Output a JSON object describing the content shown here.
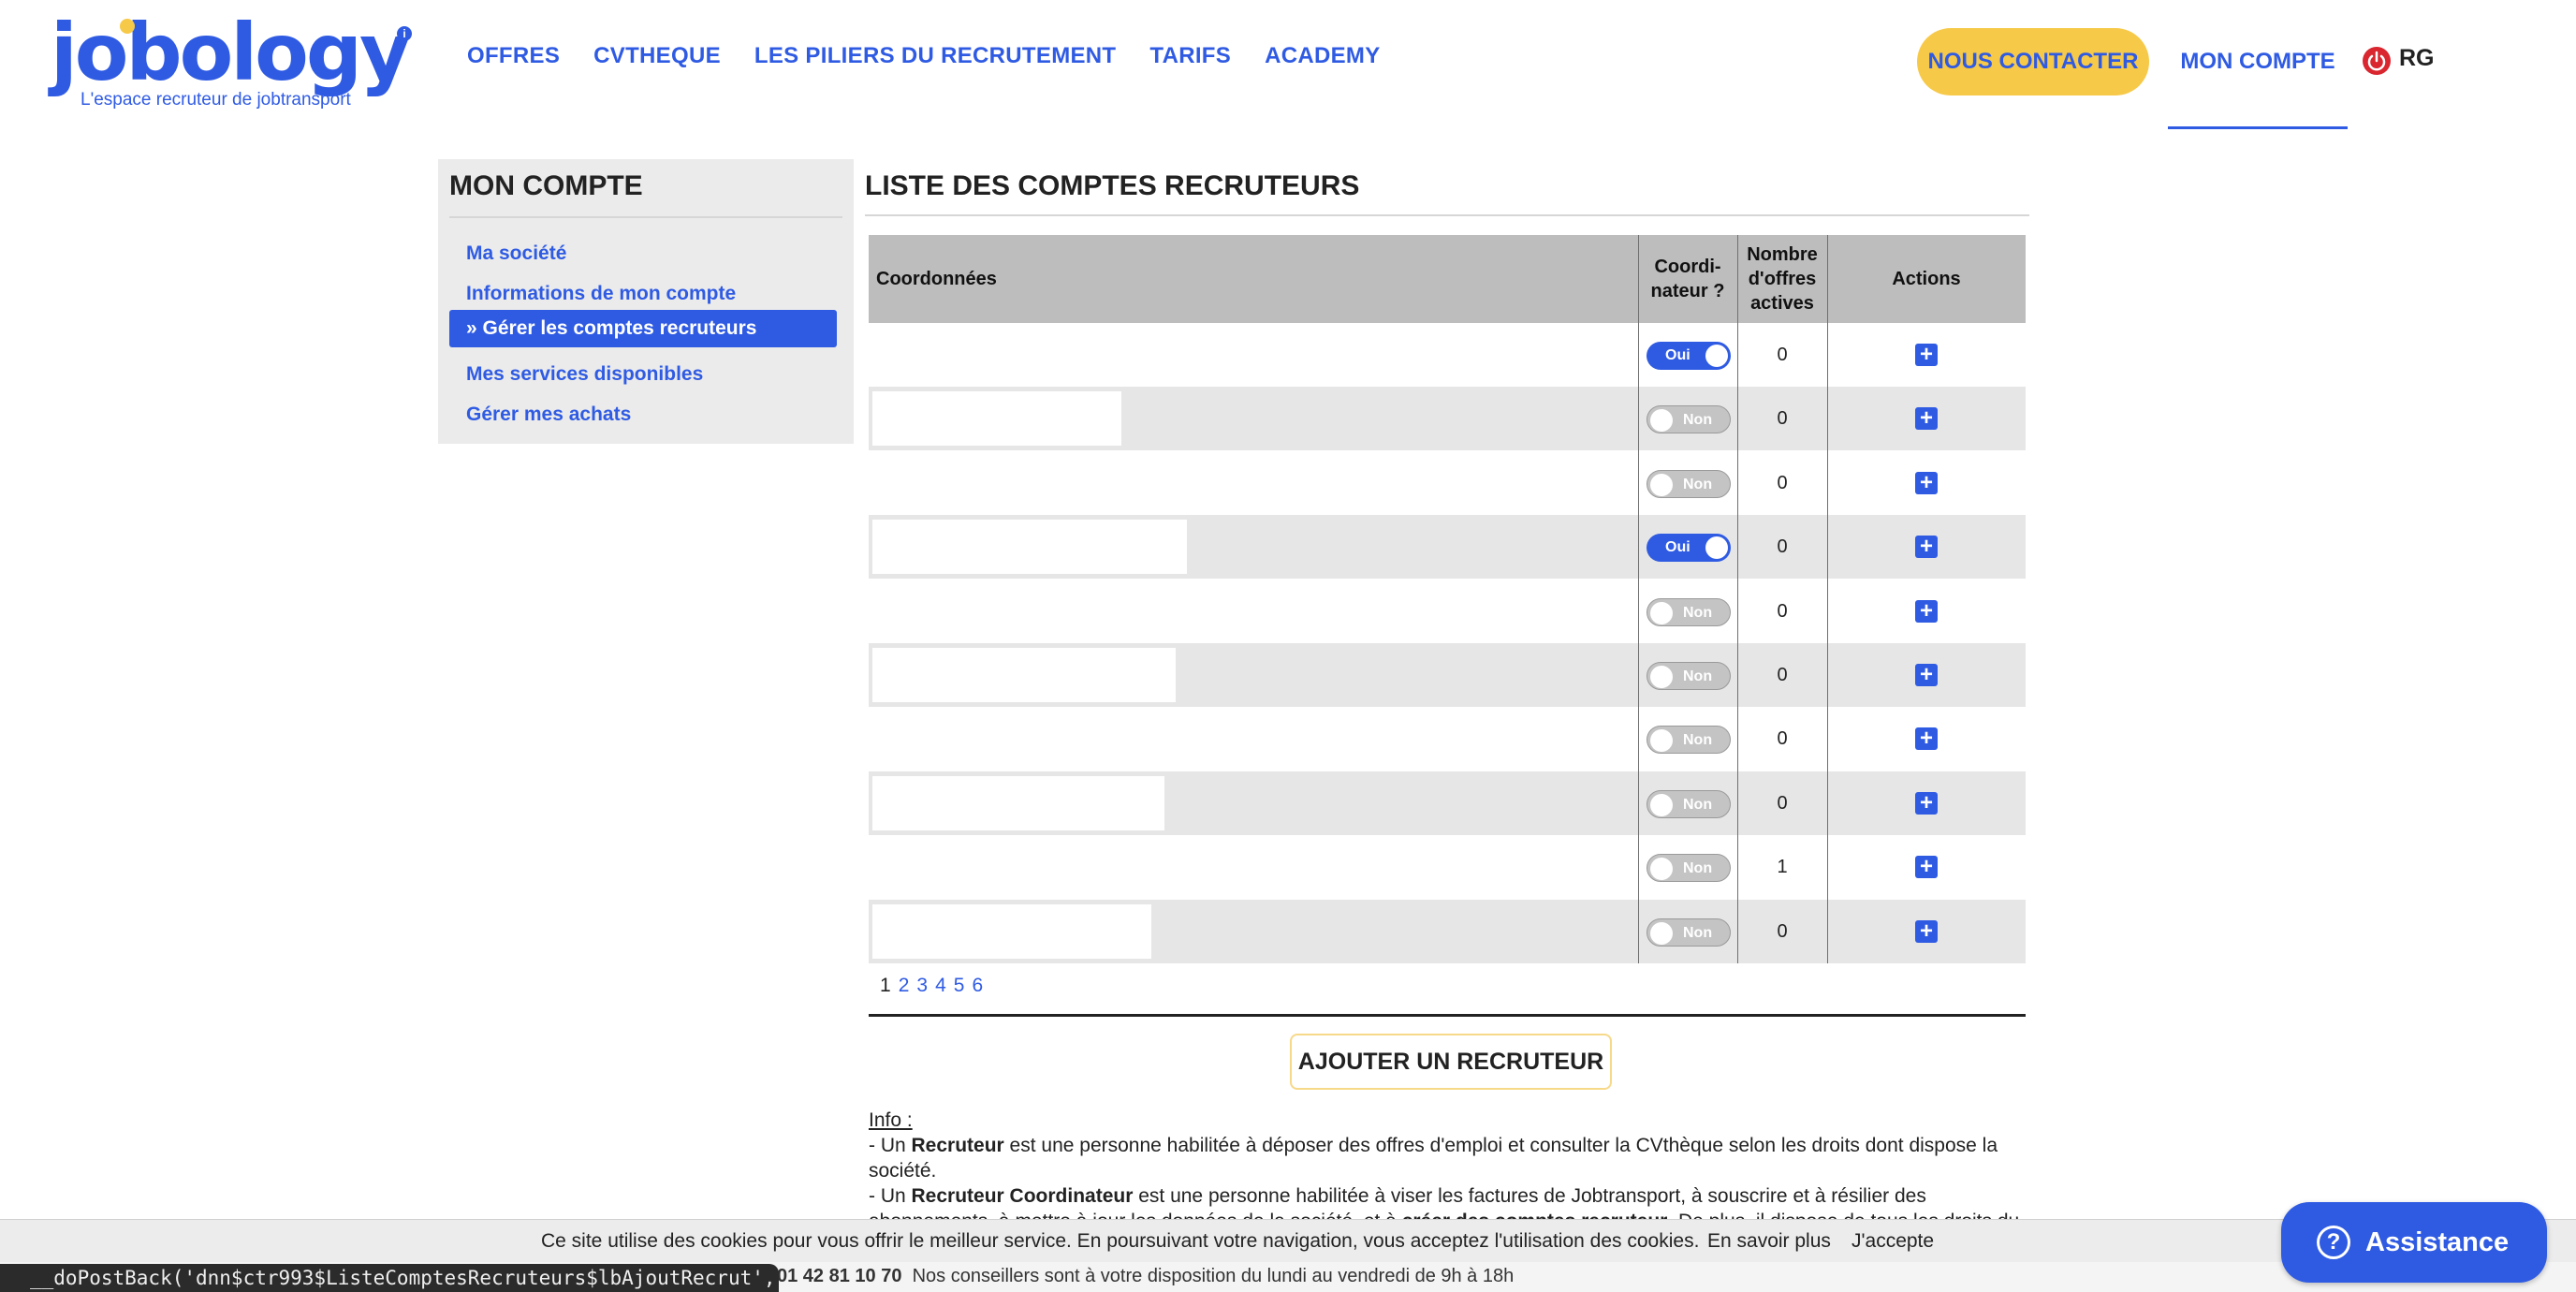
{
  "header": {
    "logo_text": "jobology",
    "logo_tagline": "L'espace recruteur de jobtransport",
    "nav": [
      "OFFRES",
      "CVTHEQUE",
      "LES PILIERS DU RECRUTEMENT",
      "TARIFS",
      "ACADEMY"
    ],
    "contact_label": "NOUS CONTACTER",
    "account_label": "MON COMPTE",
    "user_initials": "RG",
    "accent_color": "#2f5be3",
    "highlight_color": "#f7c948"
  },
  "sidebar": {
    "title": "MON COMPTE",
    "items": [
      {
        "label": "Ma société"
      },
      {
        "label": "Informations de mon compte"
      },
      {
        "label": "» Gérer les comptes recruteurs",
        "active": true
      },
      {
        "label": "Mes services disponibles"
      },
      {
        "label": "Gérer mes achats"
      }
    ]
  },
  "main": {
    "title": "LISTE DES COMPTES RECRUTEURS",
    "columns": {
      "coordonnees": "Coordonnées",
      "coordinateur": "Coordi-\nnateur ?",
      "nb_offres": "Nombre\nd'offres\nactives",
      "actions": "Actions"
    },
    "rows": [
      {
        "coordinateur": "Oui",
        "on": true,
        "offres": "0"
      },
      {
        "coordinateur": "Non",
        "on": false,
        "offres": "0"
      },
      {
        "coordinateur": "Non",
        "on": false,
        "offres": "0"
      },
      {
        "coordinateur": "Oui",
        "on": true,
        "offres": "0"
      },
      {
        "coordinateur": "Non",
        "on": false,
        "offres": "0"
      },
      {
        "coordinateur": "Non",
        "on": false,
        "offres": "0"
      },
      {
        "coordinateur": "Non",
        "on": false,
        "offres": "0"
      },
      {
        "coordinateur": "Non",
        "on": false,
        "offres": "0"
      },
      {
        "coordinateur": "Non",
        "on": false,
        "offres": "1"
      },
      {
        "coordinateur": "Non",
        "on": false,
        "offres": "0"
      }
    ],
    "add_icon": "plus-square-icon",
    "pagination": {
      "current": "1",
      "pages": [
        "2",
        "3",
        "4",
        "5",
        "6"
      ]
    },
    "add_recruiter_label": "AJOUTER UN RECRUTEUR",
    "info": {
      "title": "Info :",
      "line1_prefix": "- Un ",
      "line1_bold": "Recruteur",
      "line1_rest": " est une personne habilitée à déposer des offres d'emploi et consulter la CVthèque selon les droits dont dispose la société.",
      "line2_prefix": "- Un ",
      "line2_bold": "Recruteur Coordinateur",
      "line2_rest": " est une personne habilitée à viser les factures de Jobtransport, à souscrire et à résilier des abonnements, à mettre à jour les données de la société, et à ",
      "line2_bold2": "créer des comptes recruteur",
      "line2_end": ". De plus, il dispose de tous les droits du"
    }
  },
  "cookie": {
    "text": "Ce site utilise des cookies pour vous offrir le meilleur service. En poursuivant votre navigation, vous acceptez l'utilisation des cookies.",
    "more": "En savoir plus",
    "accept": "J'accepte"
  },
  "footer": {
    "phone": "01 42 81 10 70",
    "text": "Nos conseillers sont à votre disposition du lundi au vendredi de 9h à 18h",
    "status_tip": "__doPostBack('dnn$ctr993$ListeComptesRecruteurs$lbAjoutRecrut','')"
  },
  "assistance": {
    "label": "Assistance",
    "icon": "question-circle-icon"
  }
}
